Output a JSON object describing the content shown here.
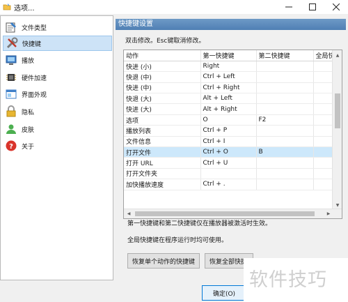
{
  "window": {
    "title": "选项..."
  },
  "sidebar": {
    "items": [
      {
        "label": "文件类型",
        "icon": "file-types-icon",
        "selected": false
      },
      {
        "label": "快捷键",
        "icon": "shortcut-tools-icon",
        "selected": true
      },
      {
        "label": "播放",
        "icon": "playback-monitor-icon",
        "selected": false
      },
      {
        "label": "硬件加速",
        "icon": "hardware-chip-icon",
        "selected": false
      },
      {
        "label": "界面外观",
        "icon": "appearance-window-icon",
        "selected": false
      },
      {
        "label": "隐私",
        "icon": "privacy-lock-icon",
        "selected": false
      },
      {
        "label": "皮肤",
        "icon": "skin-user-icon",
        "selected": false
      },
      {
        "label": "关于",
        "icon": "about-help-icon",
        "selected": false
      }
    ]
  },
  "panel": {
    "header": "快捷键设置",
    "hint": "双击修改。Esc键取消修改。",
    "columns": [
      "动作",
      "第一快捷键",
      "第二快捷键",
      "全局快"
    ],
    "rows": [
      {
        "action": "快进 (小)",
        "key1": "Right",
        "key2": "",
        "selected": false
      },
      {
        "action": "快退 (中)",
        "key1": "Ctrl + Left",
        "key2": "",
        "selected": false
      },
      {
        "action": "快进 (中)",
        "key1": "Ctrl + Right",
        "key2": "",
        "selected": false
      },
      {
        "action": "快退 (大)",
        "key1": "Alt + Left",
        "key2": "",
        "selected": false
      },
      {
        "action": "快进 (大)",
        "key1": "Alt + Right",
        "key2": "",
        "selected": false
      },
      {
        "action": "选项",
        "key1": "O",
        "key2": "F2",
        "selected": false
      },
      {
        "action": "播放列表",
        "key1": "Ctrl + P",
        "key2": "",
        "selected": false
      },
      {
        "action": "文件信息",
        "key1": "Ctrl + I",
        "key2": "",
        "selected": false
      },
      {
        "action": "打开文件",
        "key1": "Ctrl + O",
        "key2": "B",
        "selected": true
      },
      {
        "action": "打开 URL",
        "key1": "Ctrl + U",
        "key2": "",
        "selected": false
      },
      {
        "action": "打开文件夹",
        "key1": "",
        "key2": "",
        "selected": false
      },
      {
        "action": "加快播放速度",
        "key1": "Ctrl + .",
        "key2": "",
        "selected": false
      }
    ],
    "note1": "第一快捷键和第二快捷键仅在播放器被激活时生效。",
    "note2": "全局快捷键在程序运行时均可使用。",
    "buttons": {
      "reset_single": "恢复单个动作的快捷键",
      "reset_all": "恢复全部快捷"
    }
  },
  "footer": {
    "ok_label": "确定(O)"
  },
  "watermark": "软件技巧",
  "colors": {
    "header_blue": "#5a88bb",
    "selection": "#cde8fb",
    "ok_border": "#0078d7"
  }
}
